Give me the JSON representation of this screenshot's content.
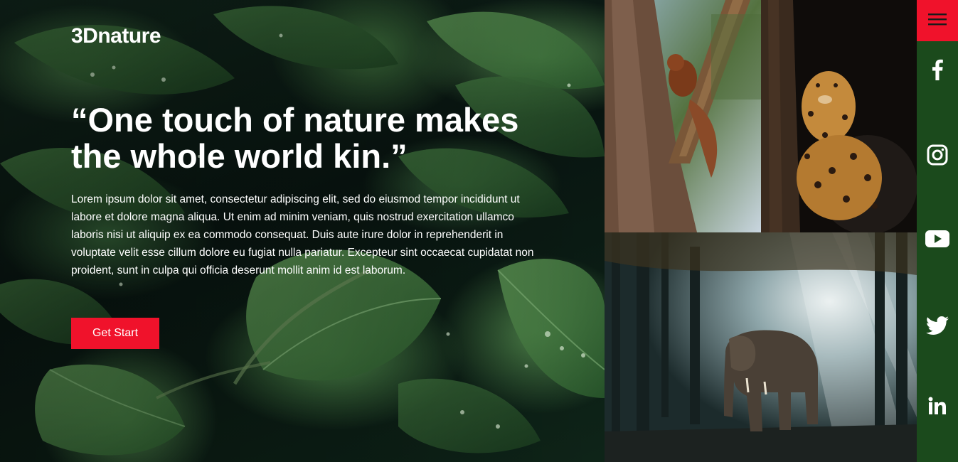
{
  "brand": {
    "logo_text": "3Dnature"
  },
  "hero": {
    "headline": "“One touch of nature makes the whole world kin.”",
    "body": "Lorem ipsum dolor sit amet, consectetur adipiscing elit, sed do eiusmod tempor incididunt ut labore et dolore magna aliqua. Ut enim ad minim veniam, quis nostrud exercitation ullamco laboris nisi ut aliquip ex ea commodo consequat. Duis aute irure dolor in reprehenderit in voluptate velit esse cillum dolore eu fugiat nulla pariatur. Excepteur sint occaecat cupidatat non proident, sunt in culpa qui officia deserunt mollit anim id est laborum.",
    "cta_label": "Get Start"
  },
  "gallery": {
    "images": [
      {
        "subject": "squirrel"
      },
      {
        "subject": "leopard"
      },
      {
        "subject": "elephant"
      }
    ]
  },
  "sidebar": {
    "menu_icon": "hamburger-menu-icon",
    "social": [
      {
        "icon": "facebook-icon"
      },
      {
        "icon": "instagram-icon"
      },
      {
        "icon": "youtube-icon"
      },
      {
        "icon": "twitter-icon"
      },
      {
        "icon": "linkedin-icon"
      }
    ]
  },
  "colors": {
    "accent": "#f0122b",
    "sidebar": "#1b4a1c",
    "text": "#ffffff"
  }
}
